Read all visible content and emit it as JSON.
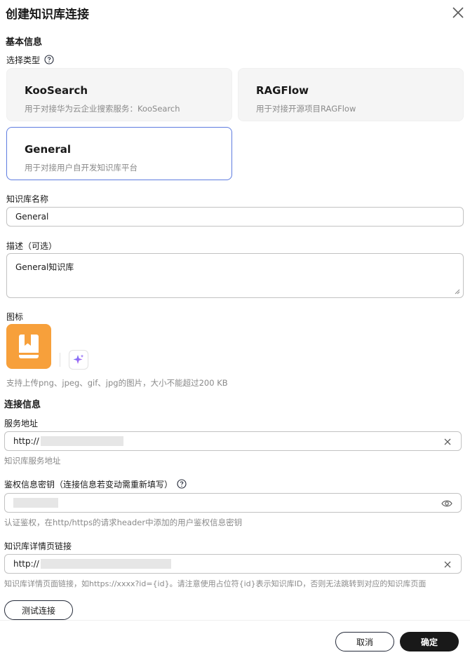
{
  "dialog": {
    "title": "创建知识库连接"
  },
  "basic": {
    "section_title": "基本信息",
    "type_label": "选择类型",
    "types": [
      {
        "title": "KooSearch",
        "desc": "用于对接华为云企业搜索服务：KooSearch",
        "selected": false
      },
      {
        "title": "RAGFlow",
        "desc": "用于对接开源项目RAGFlow",
        "selected": false
      },
      {
        "title": "General",
        "desc": "用于对接用户自开发知识库平台",
        "selected": true
      }
    ],
    "name_label": "知识库名称",
    "name_value": "General",
    "desc_label": "描述（可选）",
    "desc_value": "General知识库",
    "icon_label": "图标",
    "icon_hint": "支持上传png、jpeg、gif、jpg的图片，大小不能超过200 KB",
    "icon_color": "#f7a03b"
  },
  "connection": {
    "section_title": "连接信息",
    "url_label": "服务地址",
    "url_value": "http://",
    "url_hint": "知识库服务地址",
    "key_label": "鉴权信息密钥（连接信息若变动需重新填写）",
    "key_hint": "认证鉴权，在http/https的请求header中添加的用户鉴权信息密钥",
    "detail_label": "知识库详情页链接",
    "detail_value": "http://",
    "detail_hint": "知识库详情页面链接，如https://xxxx?id={id}。请注意使用占位符{id}表示知识库ID，否则无法跳转到对应的知识库页面",
    "test_button": "测试连接"
  },
  "footer": {
    "cancel": "取消",
    "confirm": "确定"
  },
  "colors": {
    "accent": "#5e7ce0",
    "primary_button": "#191919"
  }
}
